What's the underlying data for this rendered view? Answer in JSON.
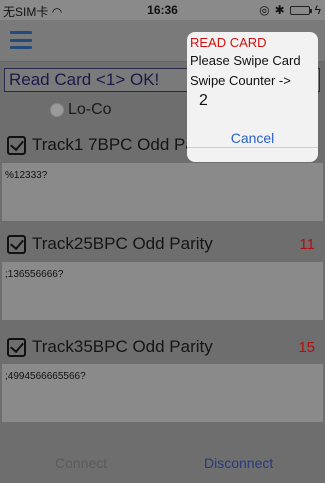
{
  "status_bar": {
    "carrier": "无SIM卡",
    "time": "16:36",
    "battery_level": 0.85
  },
  "status_message": "Read Card <1> OK!",
  "radio": {
    "label": "Lo-Co"
  },
  "tracks": [
    {
      "label": "Track1 7BPC Odd Parity",
      "count": "",
      "data": "%12333?"
    },
    {
      "label": "Track25BPC Odd Parity",
      "count": "11",
      "data": ";136556666?"
    },
    {
      "label": "Track35BPC Odd Parity",
      "count": "15",
      "data": ";4994566665566?"
    }
  ],
  "buttons": {
    "connect": "Connect",
    "disconnect": "Disconnect"
  },
  "alert": {
    "title": "READ CARD",
    "line1": "Please Swipe Card",
    "line2": "Swipe Counter ->",
    "counter": "2",
    "cancel": "Cancel"
  }
}
